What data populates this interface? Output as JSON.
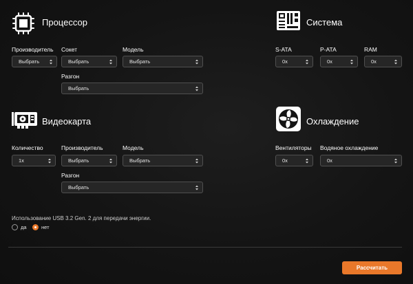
{
  "processor": {
    "title": "Процессор",
    "manufacturer_label": "Производитель",
    "manufacturer_value": "Выбрать",
    "socket_label": "Сокет",
    "socket_value": "Выбрать",
    "model_label": "Модель",
    "model_value": "Выбрать",
    "overclock_label": "Разгон",
    "overclock_value": "Выбрать"
  },
  "system": {
    "title": "Система",
    "sata_label": "S-ATA",
    "sata_value": "0x",
    "pata_label": "P-ATA",
    "pata_value": "0x",
    "ram_label": "RAM",
    "ram_value": "0x"
  },
  "gpu": {
    "title": "Видеокарта",
    "quantity_label": "Количество",
    "quantity_value": "1x",
    "manufacturer_label": "Производитель",
    "manufacturer_value": "Выбрать",
    "model_label": "Модель",
    "model_value": "Выбрать",
    "overclock_label": "Разгон",
    "overclock_value": "Выбрать"
  },
  "cooling": {
    "title": "Охлаждение",
    "fans_label": "Вентиляторы",
    "fans_value": "0x",
    "water_label": "Водяное охлаждение",
    "water_value": "0x"
  },
  "usb": {
    "note": "Использование USB 3.2 Gen. 2 для передачи энергии.",
    "option_yes": "да",
    "option_no": "нет",
    "selected": "нет"
  },
  "calculate_label": "Рассчитать",
  "colors": {
    "accent": "#e9782a",
    "background": "#141414",
    "field_bg": "#262626",
    "field_border": "#505050"
  }
}
